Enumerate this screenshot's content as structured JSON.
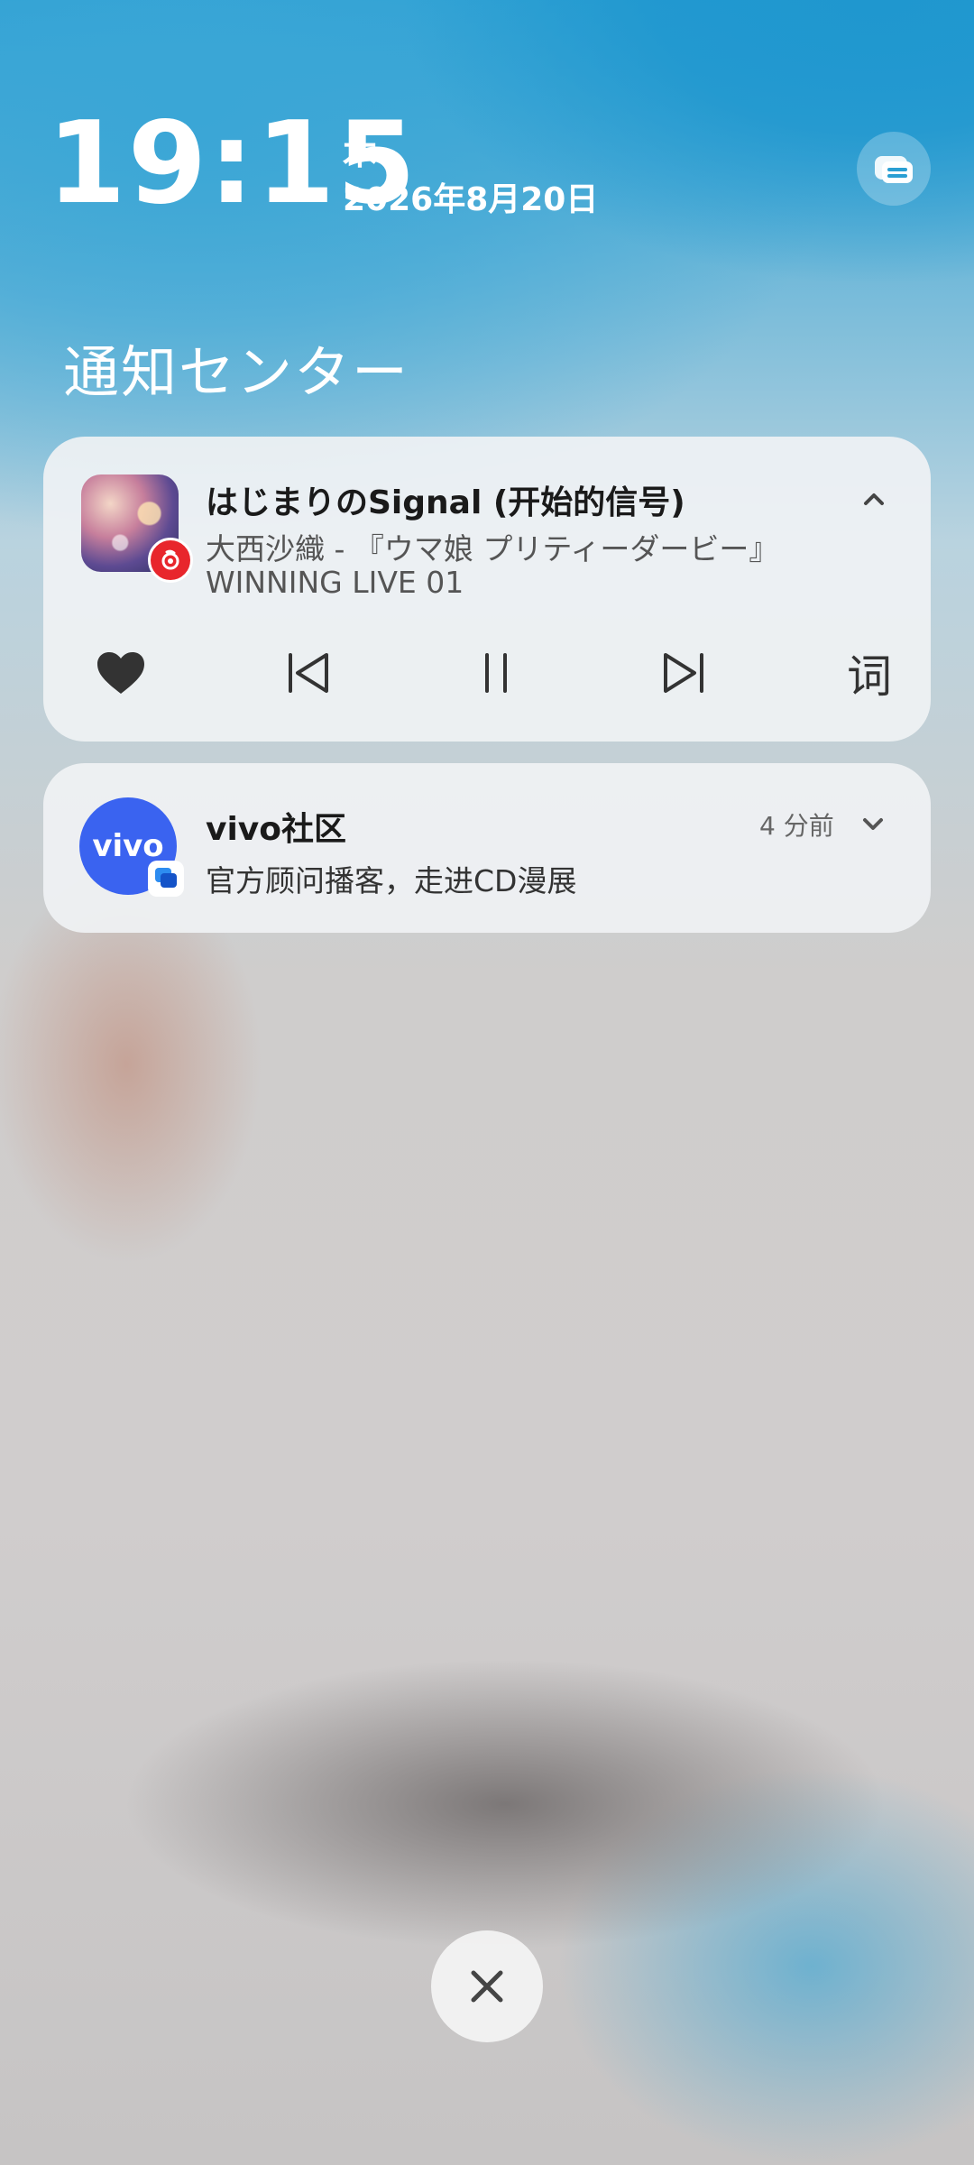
{
  "clock": {
    "time": "19:15",
    "weekday": "木",
    "date": "2026年8月20日"
  },
  "notification_center": {
    "title": "通知センター"
  },
  "music": {
    "title": "はじまりのSignal (开始的信号)",
    "artist": "大西沙織 - 『ウマ娘 プリティーダービー』",
    "album": "WINNING LIVE 01",
    "lyrics_label": "词",
    "app_badge_color": "#e8262c"
  },
  "notification": {
    "app_logo_text": "vivo",
    "app_name": "vivo社区",
    "time_ago": "4 分前",
    "message": "官方顾问播客，走进CD漫展",
    "logo_color": "#3a63f0"
  }
}
